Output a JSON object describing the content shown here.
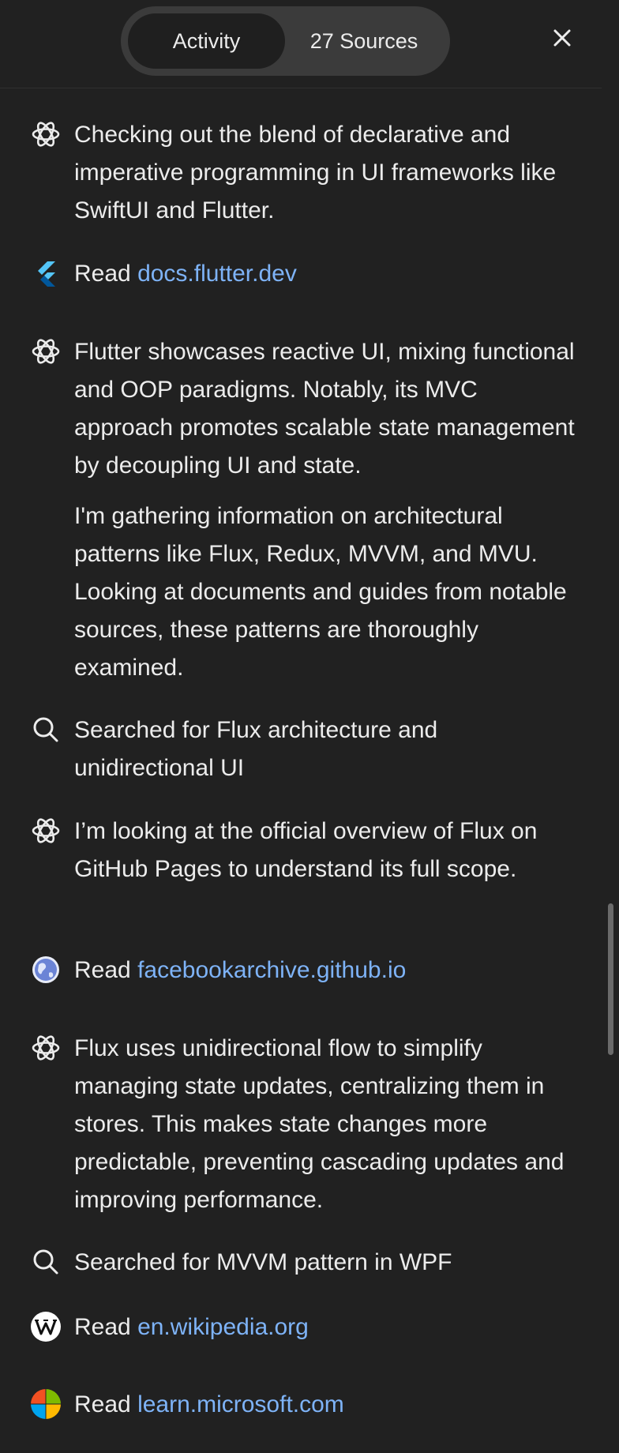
{
  "header": {
    "tabs": [
      {
        "label": "Activity",
        "active": true
      },
      {
        "label": "27 Sources",
        "active": false
      }
    ],
    "close_icon": "close-icon"
  },
  "activity": [
    {
      "icon": "openai-icon",
      "paragraphs": [
        "Checking out the blend of declarative and imperative programming in UI frameworks like SwiftUI and Flutter."
      ]
    },
    {
      "icon": "flutter-icon",
      "prefix": "Read",
      "link": "docs.flutter.dev"
    },
    {
      "icon": "openai-icon",
      "paragraphs": [
        "Flutter showcases reactive UI, mixing functional and OOP paradigms. Notably, its MVC approach promotes scalable state management by decoupling UI and state.",
        "I'm gathering information on architectural patterns like Flux, Redux, MVVM, and MVU. Looking at documents and guides from notable sources, these patterns are thoroughly examined."
      ]
    },
    {
      "icon": "search-icon",
      "paragraphs": [
        "Searched for Flux architecture and unidirectional UI"
      ]
    },
    {
      "icon": "openai-icon",
      "paragraphs": [
        "I’m looking at the official overview of Flux on GitHub Pages to understand its full scope."
      ]
    },
    {
      "icon": "globe-icon",
      "prefix": "Read",
      "link": "facebookarchive.github.io"
    },
    {
      "icon": "openai-icon",
      "paragraphs": [
        "Flux uses unidirectional flow to simplify managing state updates, centralizing them in stores. This makes state changes more predictable, preventing cascading updates and improving performance."
      ]
    },
    {
      "icon": "search-icon",
      "paragraphs": [
        "Searched for MVVM pattern in WPF"
      ]
    },
    {
      "icon": "wikipedia-icon",
      "prefix": "Read",
      "link": "en.wikipedia.org"
    },
    {
      "icon": "microsoft-icon",
      "prefix": "Read",
      "link": "learn.microsoft.com"
    }
  ],
  "colors": {
    "background": "#212121",
    "text": "#ececec",
    "link": "#7eb3f7",
    "segment": "#3b3b3b"
  }
}
